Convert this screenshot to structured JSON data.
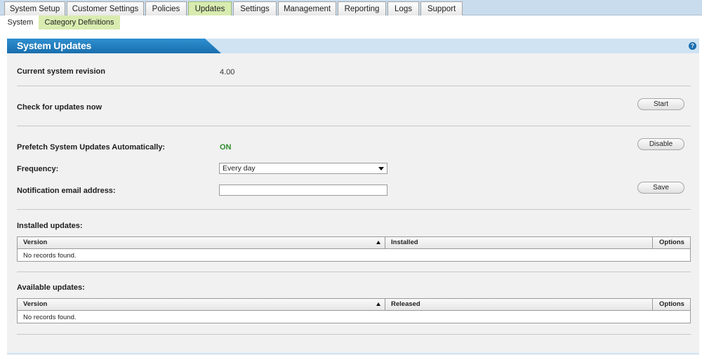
{
  "top_tabs": [
    {
      "label": "System Setup",
      "active": false
    },
    {
      "label": "Customer Settings",
      "active": false
    },
    {
      "label": "Policies",
      "active": false
    },
    {
      "label": "Updates",
      "active": true
    },
    {
      "label": "Settings",
      "active": false
    },
    {
      "label": "Management",
      "active": false
    },
    {
      "label": "Reporting",
      "active": false
    },
    {
      "label": "Logs",
      "active": false
    },
    {
      "label": "Support",
      "active": false
    }
  ],
  "sub_tabs": [
    {
      "label": "System",
      "active": false
    },
    {
      "label": "Category Definitions",
      "active": true
    }
  ],
  "panel": {
    "title": "System Updates",
    "help_icon": "help-icon",
    "help_glyph": "?"
  },
  "revision": {
    "label": "Current system revision",
    "value": "4.00"
  },
  "check": {
    "label": "Check for updates now",
    "button": "Start"
  },
  "prefetch": {
    "label": "Prefetch System Updates Automatically:",
    "value": "ON",
    "button": "Disable"
  },
  "frequency": {
    "label": "Frequency:",
    "value": "Every day"
  },
  "email": {
    "label": "Notification email address:",
    "value": "",
    "button": "Save"
  },
  "installed": {
    "title": "Installed updates:",
    "columns": [
      "Version",
      "Installed",
      "Options"
    ],
    "empty": "No records found."
  },
  "available": {
    "title": "Available updates:",
    "columns": [
      "Version",
      "Released",
      "Options"
    ],
    "empty": "No records found."
  }
}
